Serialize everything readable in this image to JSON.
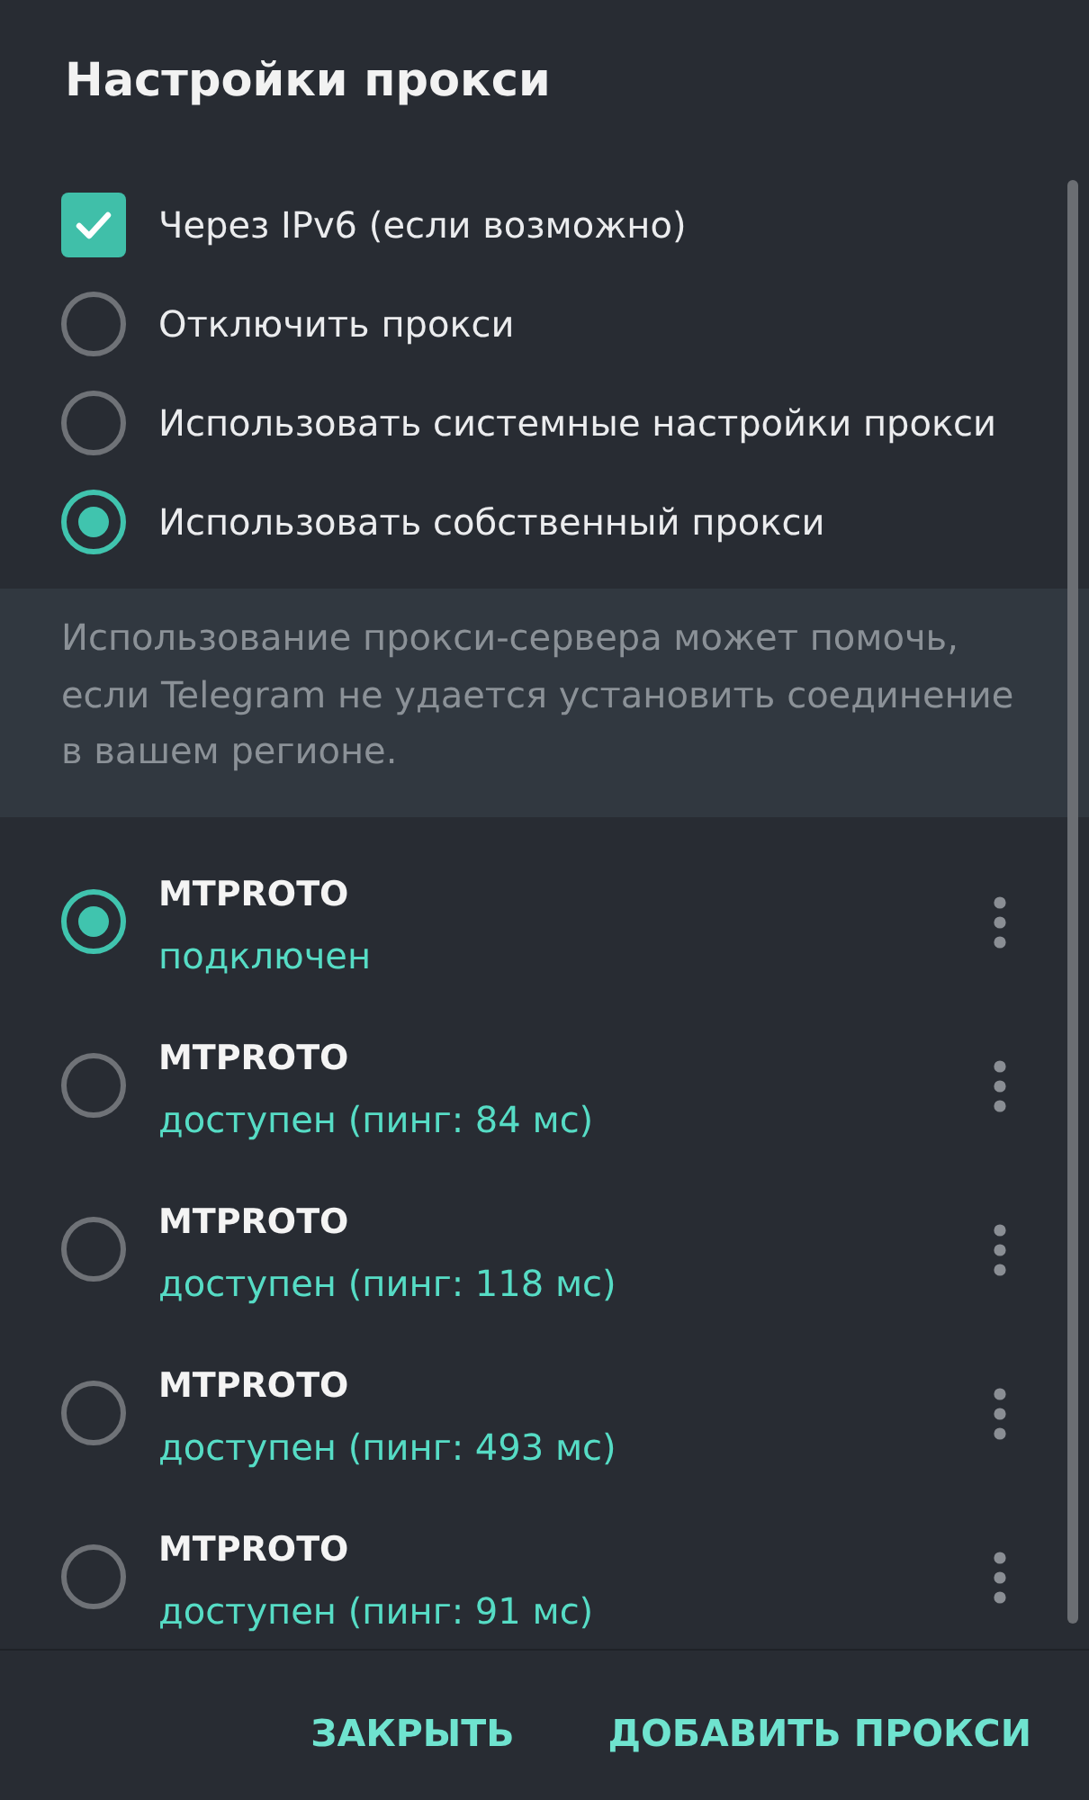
{
  "title": "Настройки прокси",
  "options": [
    {
      "kind": "checkbox",
      "label": "Через IPv6 (если возможно)",
      "checked": true
    },
    {
      "kind": "radio",
      "label": "Отключить прокси",
      "selected": false
    },
    {
      "kind": "radio",
      "label": "Использовать системные настройки прокси",
      "selected": false
    },
    {
      "kind": "radio",
      "label": "Использовать собственный прокси",
      "selected": true
    }
  ],
  "info": "Использование прокси-сервера может помочь, если Telegram не удается установить соединение в вашем регионе.",
  "proxies": [
    {
      "name": "MTPROTO",
      "status": "подключен",
      "selected": true
    },
    {
      "name": "MTPROTO",
      "status": "доступен (пинг: 84 мс)",
      "selected": false
    },
    {
      "name": "MTPROTO",
      "status": "доступен (пинг: 118 мс)",
      "selected": false
    },
    {
      "name": "MTPROTO",
      "status": "доступен (пинг: 493 мс)",
      "selected": false
    },
    {
      "name": "MTPROTO",
      "status": "доступен (пинг: 91 мс)",
      "selected": false
    }
  ],
  "buttons": [
    "ЗАКРЫТЬ",
    "ДОБАВИТЬ ПРОКСИ"
  ]
}
